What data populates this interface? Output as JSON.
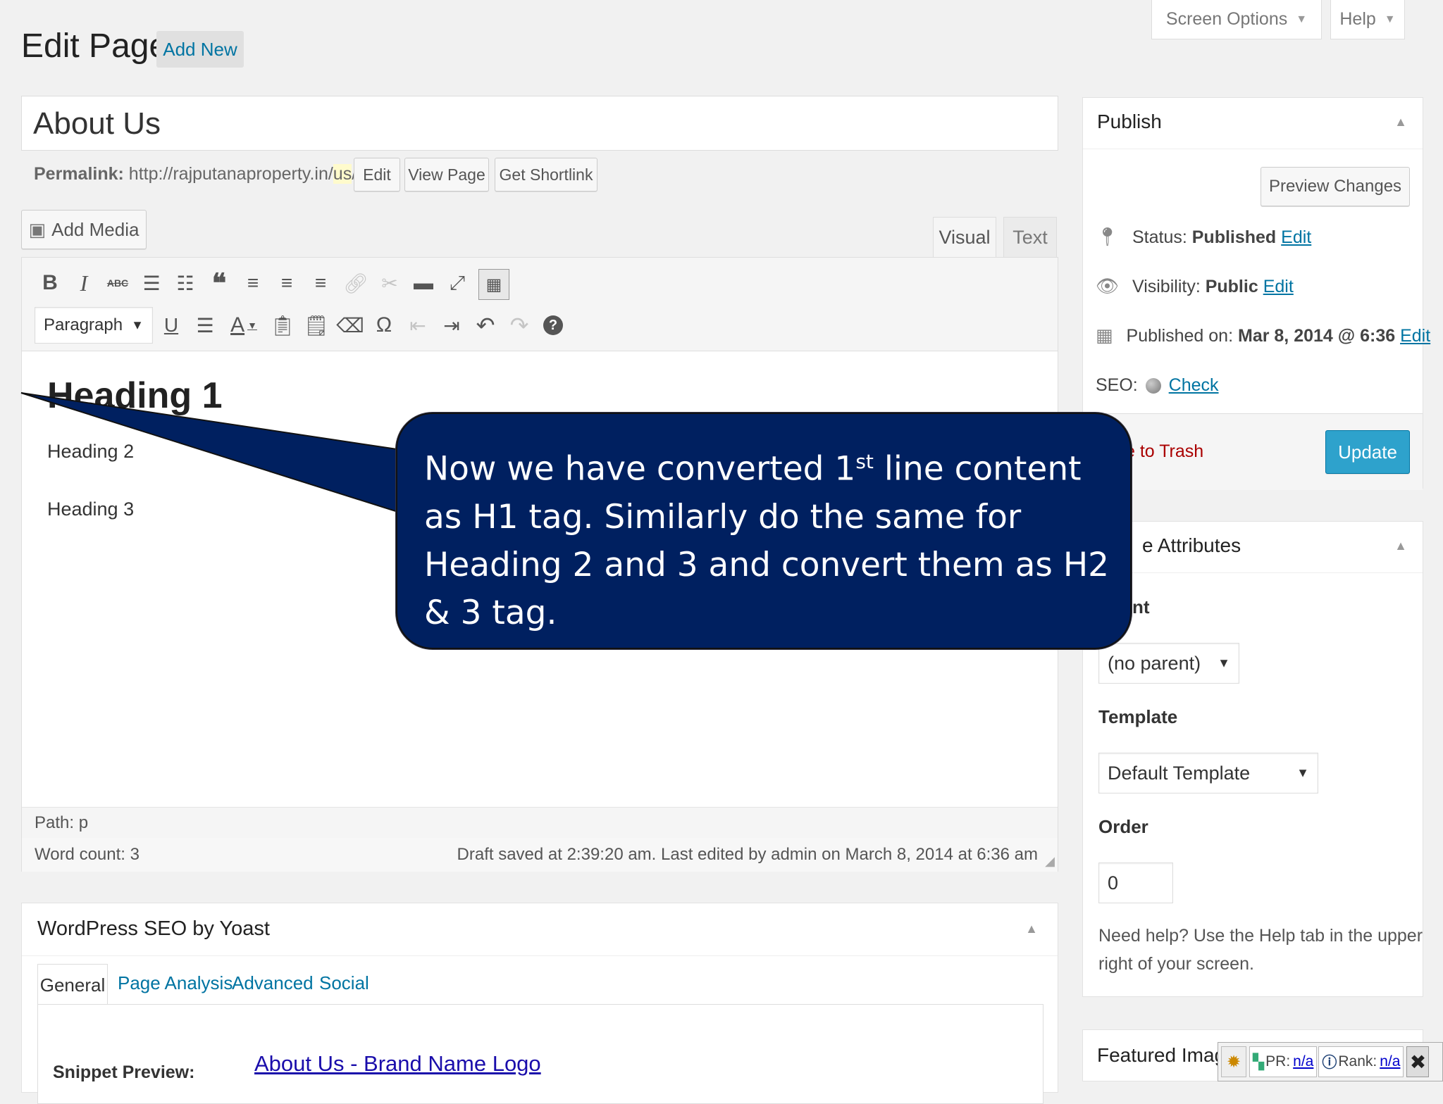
{
  "header": {
    "title": "Edit Page",
    "add_new": "Add New",
    "screen_options": "Screen Options",
    "help": "Help"
  },
  "editor": {
    "post_title": "About Us",
    "permalink_label": "Permalink:",
    "permalink_base": "http://rajputanaproperty.in/",
    "permalink_slug": "us",
    "permalink_end": "/",
    "edit_btn": "Edit",
    "view_page_btn": "View Page",
    "shortlink_btn": "Get Shortlink",
    "add_media": "Add Media",
    "tab_visual": "Visual",
    "tab_text": "Text",
    "format_select": "Paragraph",
    "content": {
      "h1": "Heading 1",
      "h2": "Heading 2",
      "h3": "Heading 3"
    },
    "path": "Path: p",
    "word_count": "Word count: 3",
    "draft_status": "Draft saved at 2:39:20 am. Last edited by admin on March 8, 2014 at 6:36 am"
  },
  "publish": {
    "title": "Publish",
    "preview": "Preview Changes",
    "status_label": "Status:",
    "status_value": "Published",
    "visibility_label": "Visibility:",
    "visibility_value": "Public",
    "published_label": "Published on:",
    "published_value": "Mar 8, 2014 @ 6:36",
    "edit": "Edit",
    "seo_label": "SEO:",
    "seo_check": "Check",
    "trash": "e to Trash",
    "update": "Update"
  },
  "attributes": {
    "title": "e Attributes",
    "parent_label": "nt",
    "parent_value": "(no parent)",
    "template_label": "Template",
    "template_value": "Default Template",
    "order_label": "Order",
    "order_value": "0",
    "help_text_1": "Need help? Use the Help tab in the upper",
    "help_text_2": "right of your screen."
  },
  "featured": {
    "title": "Featured Imag"
  },
  "seo_box": {
    "title": "WordPress SEO by Yoast",
    "tabs": [
      "General",
      "Page Analysis",
      "Advanced",
      "Social"
    ],
    "snippet_label": "Snippet Preview:",
    "snippet_title": "About Us - Brand Name Logo"
  },
  "seoquake": {
    "pr_label": "PR:",
    "pr_value": "n/a",
    "rank_label": "Rank:",
    "rank_value": "n/a"
  },
  "callout": {
    "line1_a": "Now we have converted 1",
    "line1_sup": "st",
    "line1_b": " line content",
    "line2": "as H1 tag. Similarly do the same for",
    "line3": "Heading 2 and 3 and convert them as H2",
    "line4": "& 3 tag."
  },
  "colors": {
    "callout_fill": "#002060",
    "update_button": "#2ea2cc",
    "link": "#0074a2",
    "trash": "#a00"
  }
}
